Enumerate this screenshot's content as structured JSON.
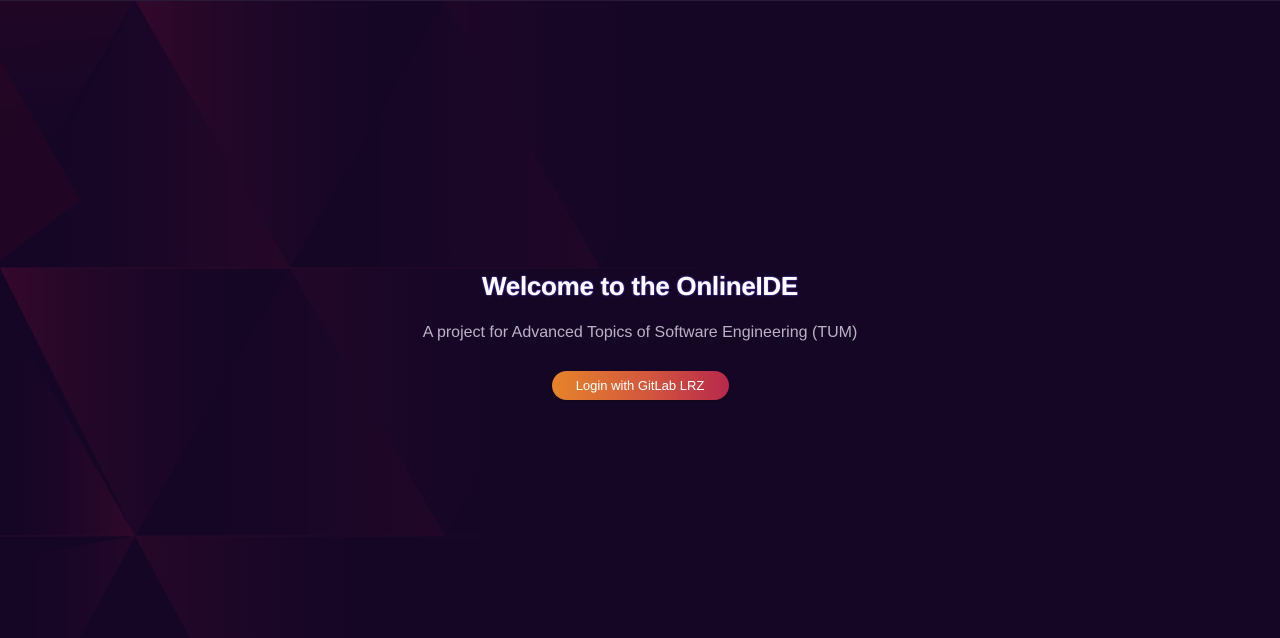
{
  "hero": {
    "title": "Welcome to the OnlineIDE",
    "subtitle": "A project for Advanced Topics of Software Engineering (TUM)",
    "login_button_label": "Login with GitLab LRZ"
  },
  "colors": {
    "background": "#150626",
    "button_gradient_start": "#e6842a",
    "button_gradient_end": "#b9284c",
    "title_text": "#ffffff",
    "subtitle_text": "#b9b2c6",
    "pattern_accent": "#6a0f3e"
  }
}
